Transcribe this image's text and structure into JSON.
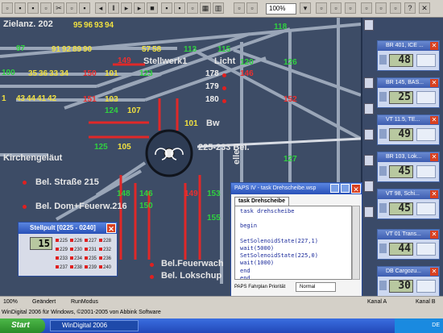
{
  "toolbar": {
    "zoom": "100%"
  },
  "track": {
    "zielanz": "Zielanz. 202",
    "stellwerk": "Stellwerk1",
    "licht": "Licht",
    "bw": "Bw",
    "kirchengelaeut": "Kirchengeläut",
    "bel_strasse": "Bel. Straße 215",
    "bel_dom": "Bel. Dom+Feuerw.216",
    "bel_range": "225-233 Bel.",
    "bel_feuerwach": "Bel.Feuerwach",
    "bel_lokschup": "Bel. Lokschup",
    "elle": "elle",
    "n_95": "95",
    "n_96": "96",
    "n_93": "93",
    "n_94": "94",
    "n_91": "91",
    "n_92": "92",
    "n_89": "89",
    "n_90": "90",
    "n_97": "97",
    "n_100": "100",
    "n_35": "35",
    "n_36": "36",
    "n_33": "33",
    "n_34": "34",
    "n_43": "43",
    "n_44": "44",
    "n_41": "41",
    "n_42": "42",
    "n_57": "57",
    "n_58": "58",
    "n_113": "113",
    "n_115": "115",
    "n_118": "118",
    "n_120": "120",
    "n_126": "126",
    "n_101": "101",
    "n_123": "123",
    "n_124": "124",
    "n_125": "125",
    "n_148": "148",
    "n_146": "146",
    "n_150": "150",
    "n_151": "151",
    "n_153": "153",
    "n_155": "155",
    "n_127": "127",
    "n_149": "149",
    "n_140": "140",
    "n_152": "152",
    "n_178": "178",
    "n_179": "179",
    "n_180": "180",
    "n_103": "103",
    "n_107": "107",
    "n_105": "105",
    "n_1": "1"
  },
  "locos": [
    {
      "name": "BR 401, ICE ...",
      "speed": "48"
    },
    {
      "name": "BR 145, BAS...",
      "speed": "25"
    },
    {
      "name": "VT 11.5, TE...",
      "speed": "49"
    },
    {
      "name": "BR 103, Lok...",
      "speed": "45"
    },
    {
      "name": "VT 98, Schi...",
      "speed": "45"
    },
    {
      "name": "VT 01 Trans...",
      "speed": "44"
    },
    {
      "name": "DB Cargozu...",
      "speed": "30"
    }
  ],
  "stellpult": {
    "title": "Stellpult [0225 - 0240]",
    "display": "15",
    "buttons": [
      "225",
      "226",
      "227",
      "228",
      "229",
      "230",
      "231",
      "232",
      "233",
      "234",
      "235",
      "236",
      "237",
      "238",
      "239",
      "240"
    ]
  },
  "paps": {
    "title": "PAPS IV - task Drehscheibe.wsp",
    "tab": "task Drehscheibe",
    "code": "task drehscheibe\n\nbegin\n\nSetSolenoidState(227,1)\nwait(5000)\nSetSolenoidState(225,0)\nwait(1000)\nend\nend",
    "footer_label": "PAPS Fahrplan Priorität",
    "priority": "Normal"
  },
  "status": {
    "zoom": "100%",
    "changed": "Geändert",
    "mode": "RunModus",
    "kanal_a": "Kanal A",
    "kanal_b": "Kanal B"
  },
  "copyright": "WinDigital 2006 für Windows, ©2001-2005 von Abbink Software",
  "taskbar": {
    "start": "Start",
    "task": "WinDigital 2006",
    "tray": "DE"
  }
}
